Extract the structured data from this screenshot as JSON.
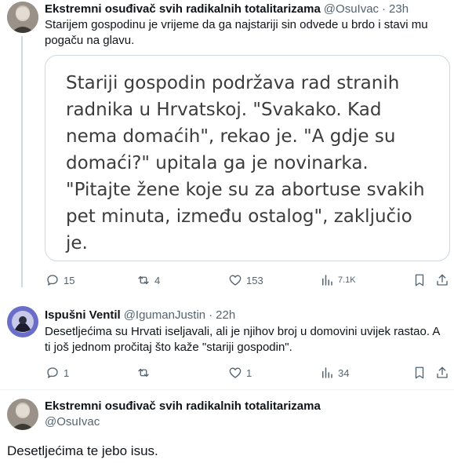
{
  "tweet1": {
    "author_name": "Ekstremni osuđivač svih radikalnih totalitarizama",
    "author_handle": "@OsuIvac",
    "separator": "·",
    "time": "23h",
    "text": "Starijem gospodinu je vrijeme da ga najstariji sin odvede u brdo i stavi mu pogaču na glavu.",
    "quoted_text": "Stariji gospodin podržava rad stranih radnika u Hrvatskoj. \"Svakako. Kad nema domaćih\", rekao je. \"A gdje su domaći?\" upitala ga je novinarka. \"Pitajte žene koje su za abortuse svakih pet minuta, između ostalog\", zaključio je.",
    "actions": {
      "replies": "15",
      "reposts": "4",
      "likes": "153",
      "views": "7.1K"
    }
  },
  "tweet2": {
    "author_name": "Ispušni Ventil",
    "author_handle": "@IgumanJustin",
    "separator": "·",
    "time": "22h",
    "text": "Desetljećima su Hrvati iseljavali, ali je njihov broj u domovini uvijek rastao. A ti još jednom pročitaj što kaže \"stariji gospodin\".",
    "actions": {
      "replies": "1",
      "reposts": "",
      "likes": "1",
      "views": "34"
    }
  },
  "tweet3": {
    "author_name": "Ekstremni osuđivač svih radikalnih totalitarizama",
    "author_handle": "@OsuIvac",
    "text": "Desetljećima te jebo isus."
  },
  "icons": {
    "reply": "reply-icon",
    "repost": "repost-icon",
    "like": "heart-icon",
    "views": "views-icon",
    "bookmark": "bookmark-icon",
    "share": "share-icon"
  },
  "colors": {
    "secondary_text": "#536471",
    "thread_line": "#cfd9de",
    "card_border": "#cfd9de"
  }
}
